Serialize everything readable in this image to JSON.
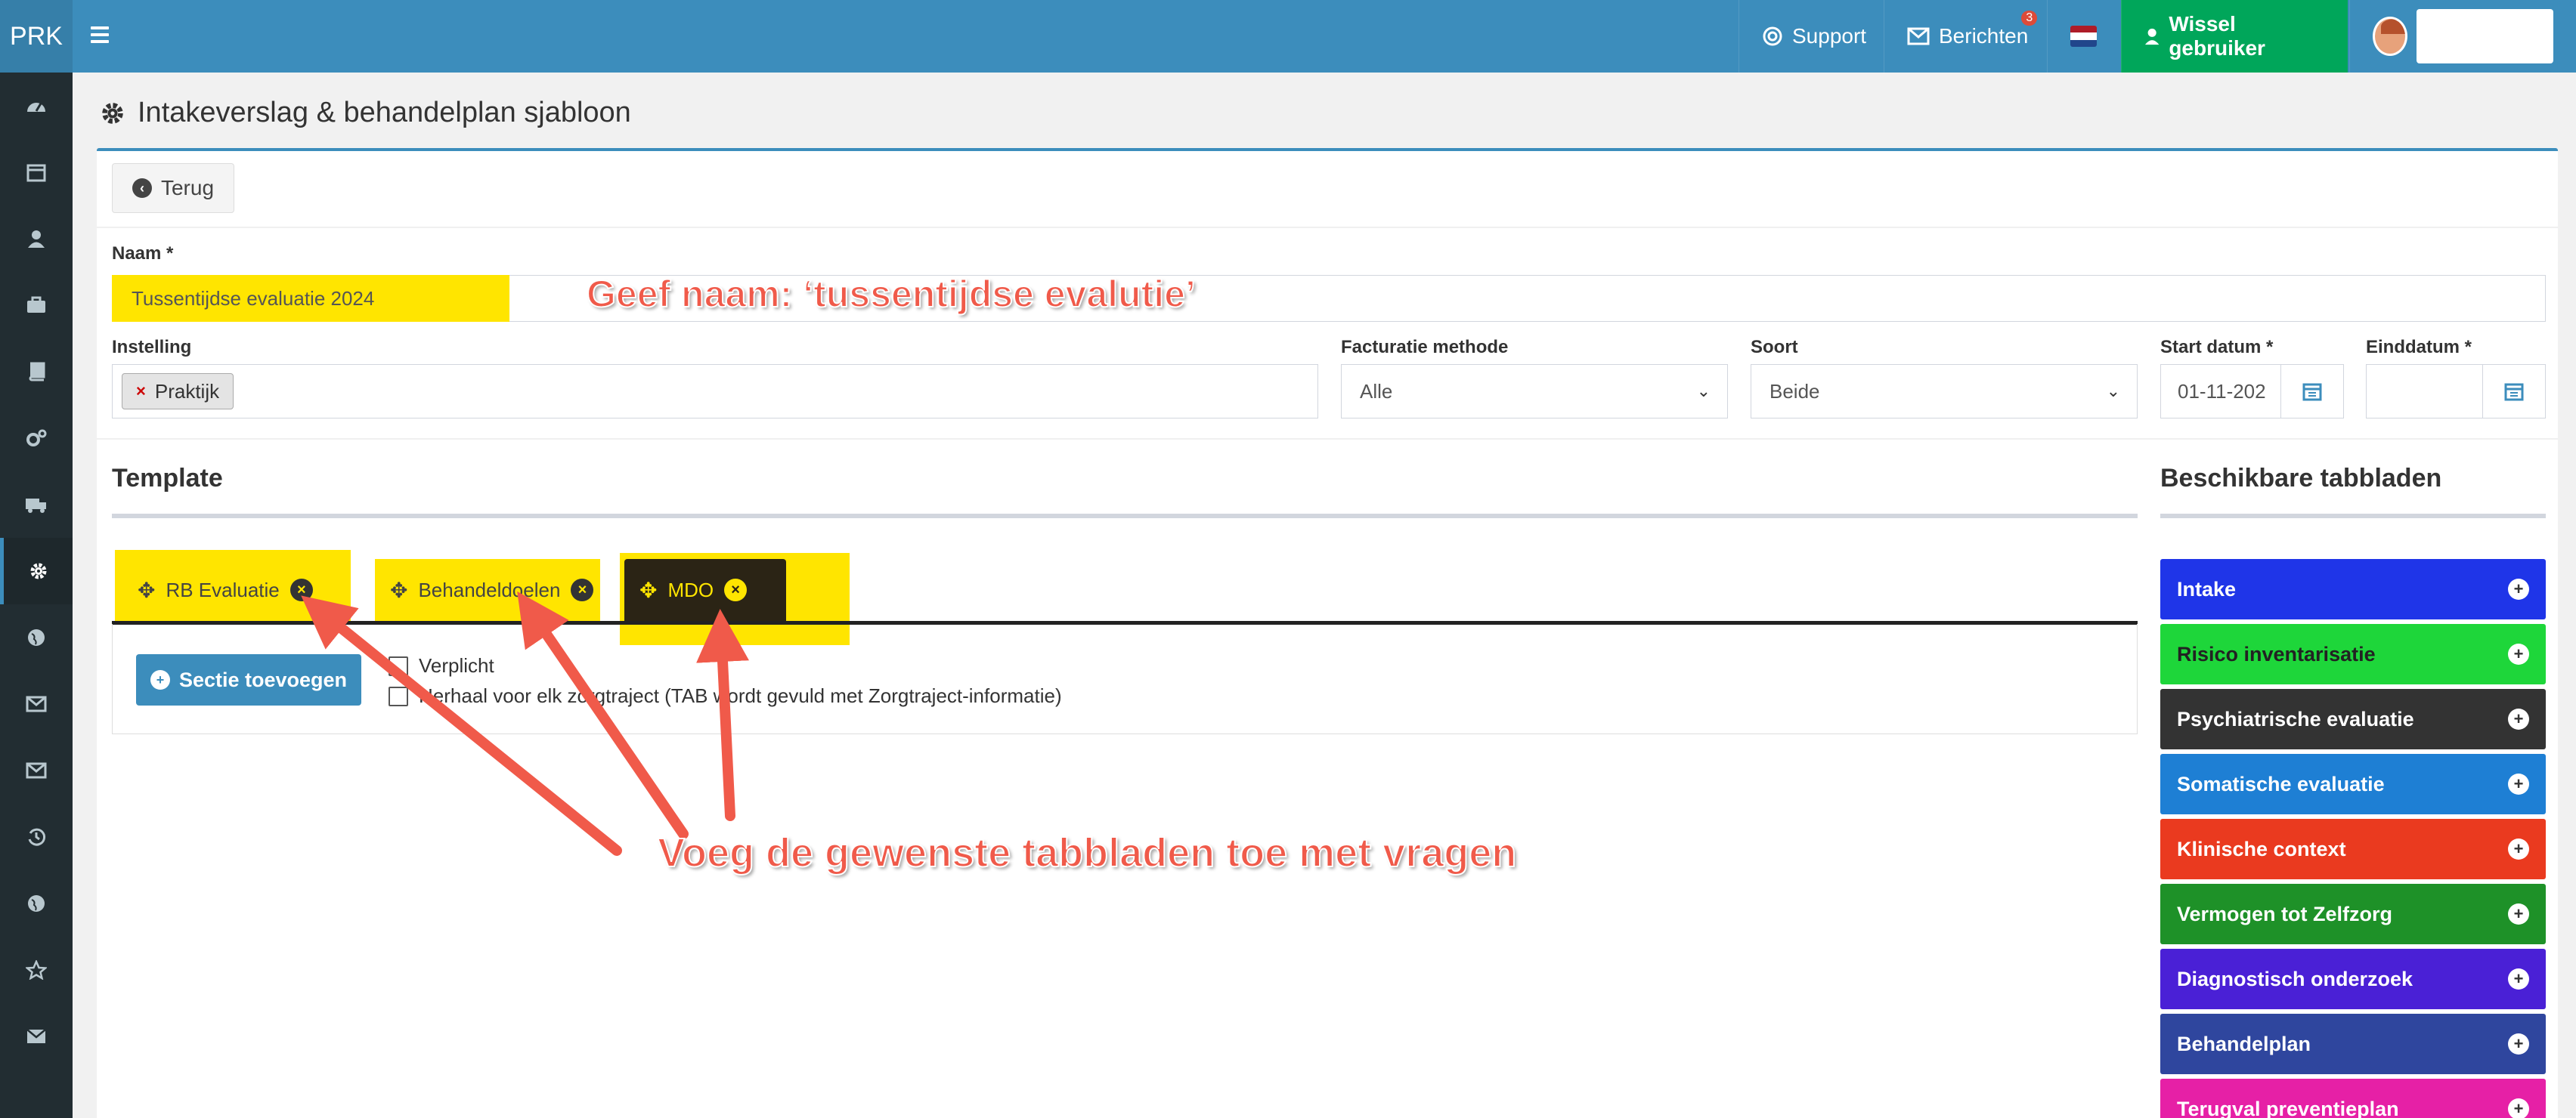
{
  "topbar": {
    "logo": "PRK",
    "support_label": "Support",
    "berichten_label": "Berichten",
    "berichten_badge": "3",
    "wissel_label": "Wissel gebruiker"
  },
  "sidebar": {
    "items": [
      "dashboard-icon",
      "calendar-icon",
      "user-icon",
      "briefcase-icon",
      "book-icon",
      "cogs-icon",
      "truck-icon",
      "cog-icon",
      "globe-icon",
      "envelope-icon",
      "envelope-icon",
      "history-icon",
      "globe-icon",
      "star-icon",
      "envelope-icon"
    ],
    "active_index": 7
  },
  "page": {
    "title": "Intakeverslag & behandelplan sjabloon",
    "back_label": "Terug"
  },
  "form": {
    "naam_label": "Naam *",
    "naam_value": "Tussentijdse evaluatie 2024",
    "instelling_label": "Instelling",
    "instelling_chip": "Praktijk",
    "facturatie_label": "Facturatie methode",
    "facturatie_value": "Alle",
    "soort_label": "Soort",
    "soort_value": "Beide",
    "start_label": "Start datum *",
    "start_value": "01-11-202",
    "eind_label": "Einddatum *",
    "eind_value": ""
  },
  "template": {
    "title": "Template",
    "tabs": [
      "RB Evaluatie",
      "Behandeldoelen",
      "MDO"
    ],
    "active_tab": "MDO",
    "add_section_label": "Sectie toevoegen",
    "verplicht_label": "Verplicht",
    "herhaal_label": "Herhaal voor elk zorgtraject (TAB wordt gevuld met Zorgtraject-informatie)"
  },
  "available": {
    "title": "Beschikbare tabbladen",
    "items": [
      {
        "label": "Intake",
        "color": "#1f35e8"
      },
      {
        "label": "Risico inventarisatie",
        "color": "#1ed63a"
      },
      {
        "label": "Psychiatrische evaluatie",
        "color": "#333333"
      },
      {
        "label": "Somatische evaluatie",
        "color": "#1e7fd4"
      },
      {
        "label": "Klinische context",
        "color": "#ea3a1f"
      },
      {
        "label": "Vermogen tot Zelfzorg",
        "color": "#1e9128"
      },
      {
        "label": "Diagnostisch onderzoek",
        "color": "#4a20d6"
      },
      {
        "label": "Behandelplan",
        "color": "#2f469e"
      },
      {
        "label": "Terugval preventieplan",
        "color": "#e620a6"
      }
    ]
  },
  "annotations": {
    "naam_note": "Geef naam: ‘tussentijdse evalutie’",
    "tabs_note": "Voeg de gewenste tabbladen toe met vragen"
  }
}
